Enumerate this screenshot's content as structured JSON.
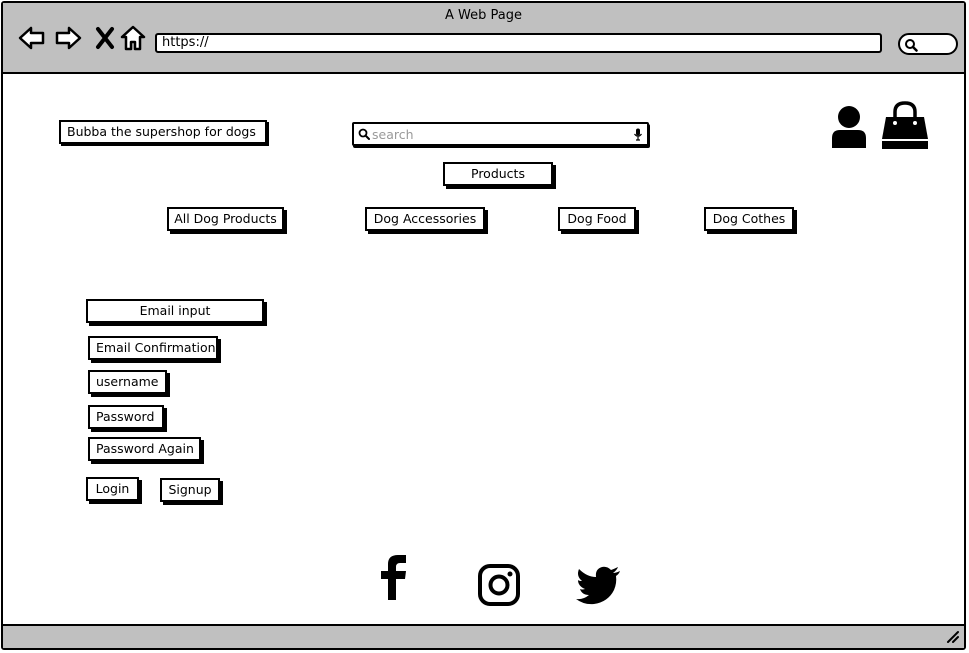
{
  "window": {
    "title": "A Web Page"
  },
  "browser": {
    "url": "https://"
  },
  "header": {
    "shop_name": "Bubba the supershop for dogs",
    "search_placeholder": "search"
  },
  "products_label": "Products",
  "categories": [
    "All Dog Products",
    "Dog Accessories",
    "Dog Food",
    "Dog Cothes"
  ],
  "form": {
    "email_input": "Email input",
    "email_confirmation": "Email Confirmation",
    "username": "username",
    "password": "Password",
    "password_again": "Password Again",
    "login": "Login",
    "signup": "Signup"
  },
  "social": [
    "facebook-icon",
    "instagram-icon",
    "twitter-icon"
  ],
  "colors": {
    "chrome": "#c0c0c0",
    "ink": "#000000",
    "placeholder": "#9a9a9a"
  }
}
